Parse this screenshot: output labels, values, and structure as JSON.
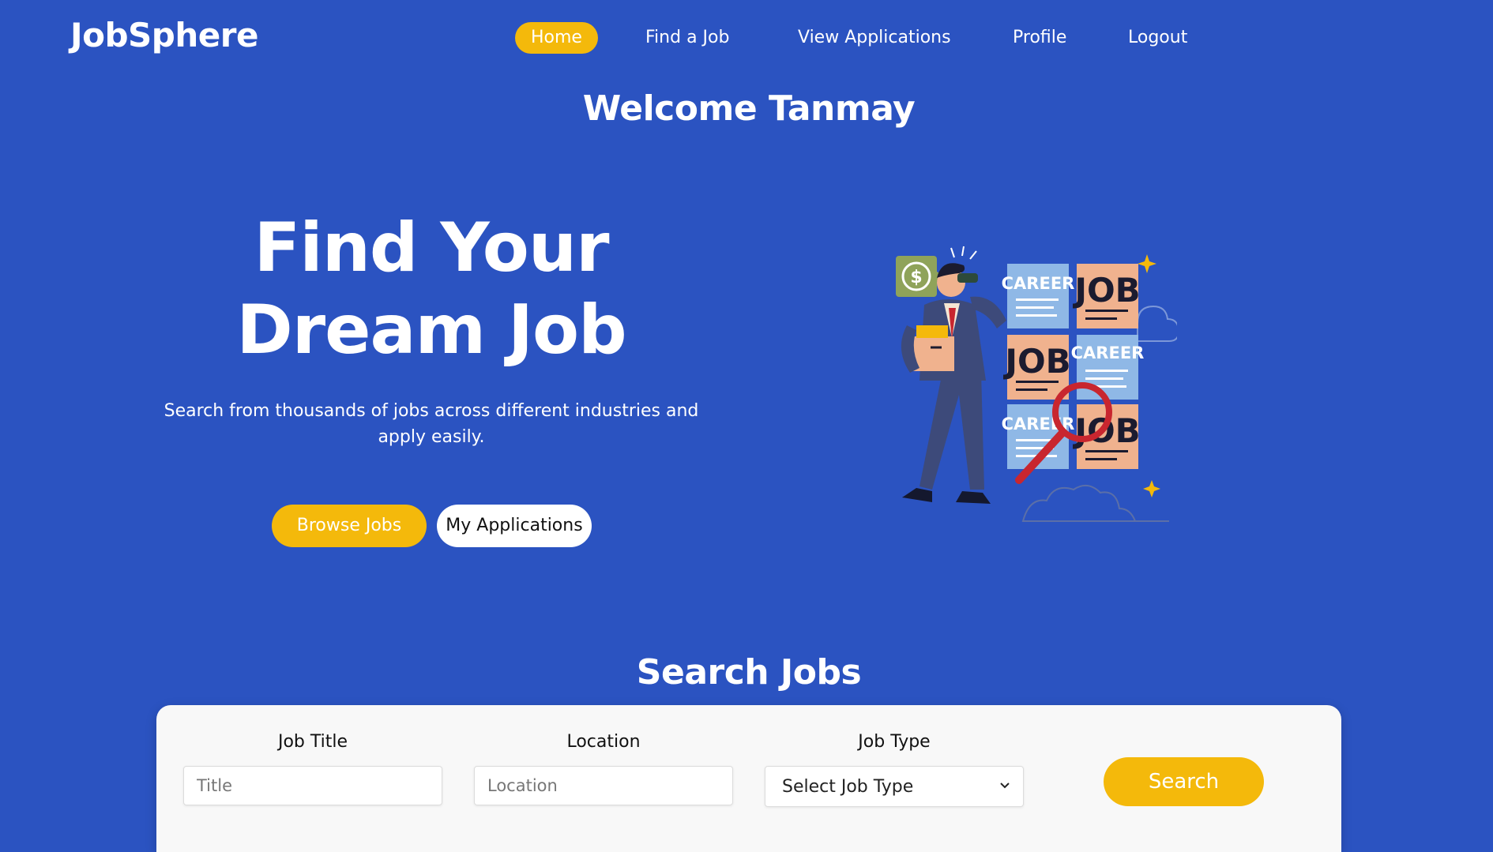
{
  "app": {
    "logo": "JobSphere"
  },
  "nav": {
    "items": [
      {
        "label": "Home",
        "active": true
      },
      {
        "label": "Find a Job",
        "active": false
      },
      {
        "label": "View Applications",
        "active": false
      },
      {
        "label": "Profile",
        "active": false
      },
      {
        "label": "Logout",
        "active": false
      }
    ]
  },
  "welcome": "Welcome Tanmay",
  "hero": {
    "title_line1": "Find Your",
    "title_line2": "Dream Job",
    "subtitle": "Search from thousands of jobs across different industries and apply easily.",
    "primary_button": "Browse Jobs",
    "secondary_button": "My Applications"
  },
  "illustration": {
    "icon": "job-search-illustration",
    "card_labels": [
      "CAREER",
      "JOB",
      "JOB",
      "CAREER",
      "CAREER",
      "JOB"
    ],
    "dollar_symbol": "$"
  },
  "search": {
    "section_title": "Search Jobs",
    "title_label": "Job Title",
    "title_placeholder": "Title",
    "location_label": "Location",
    "location_placeholder": "Location",
    "type_label": "Job Type",
    "type_selected": "Select Job Type",
    "button_label": "Search"
  },
  "colors": {
    "background": "#2b53c1",
    "accent": "#f4b90b",
    "card": "#f8f8f8",
    "text_light": "#ffffff"
  }
}
